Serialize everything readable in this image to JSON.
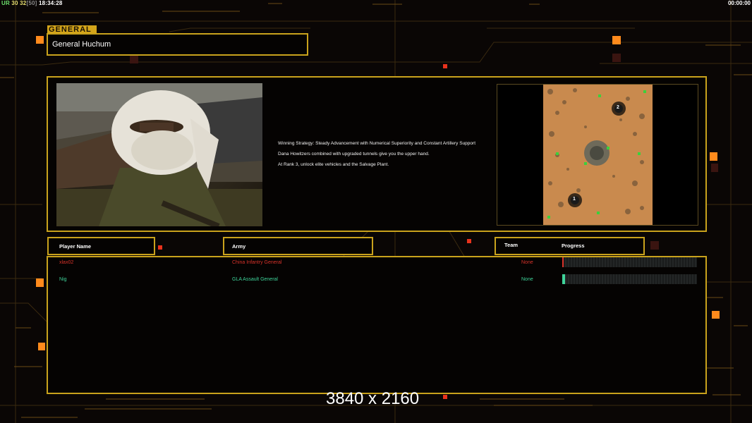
{
  "hud": {
    "left_tag": "UR",
    "left_num1": "30",
    "left_num2": "32",
    "left_bracket": "[50]",
    "left_time": "18:34:28",
    "right_time": "00:00:00"
  },
  "general": {
    "tab_label": "GENERAL",
    "name": "General Huchum"
  },
  "description": {
    "line1": "Winning Strategy: Steady Advancement with Numerical Superiority and Constant Artillery Support",
    "line2": "Dana Howitzers combined with upgraded tunnels give you the upper hand.",
    "line3": "At Rank 3, unlock elite vehicles and the Salvage Plant."
  },
  "map": {
    "marker1": "1",
    "marker2": "2"
  },
  "columns": {
    "player": "Player Name",
    "army": "Army",
    "team": "Team",
    "progress": "Progress"
  },
  "players": [
    {
      "name": "xlax02",
      "army": "China Infantry General",
      "team": "None",
      "progress": 0.01,
      "color": "#d8322a"
    },
    {
      "name": "Nig",
      "army": "GLA Assault General",
      "team": "None",
      "progress": 0.02,
      "color": "#3fd49a"
    }
  ],
  "footer": {
    "resolution": "3840 x 2160"
  },
  "colors": {
    "accent_gold": "#c9a21c",
    "orange_glow": "#ff8a1c",
    "red_dot": "#e8321c"
  }
}
